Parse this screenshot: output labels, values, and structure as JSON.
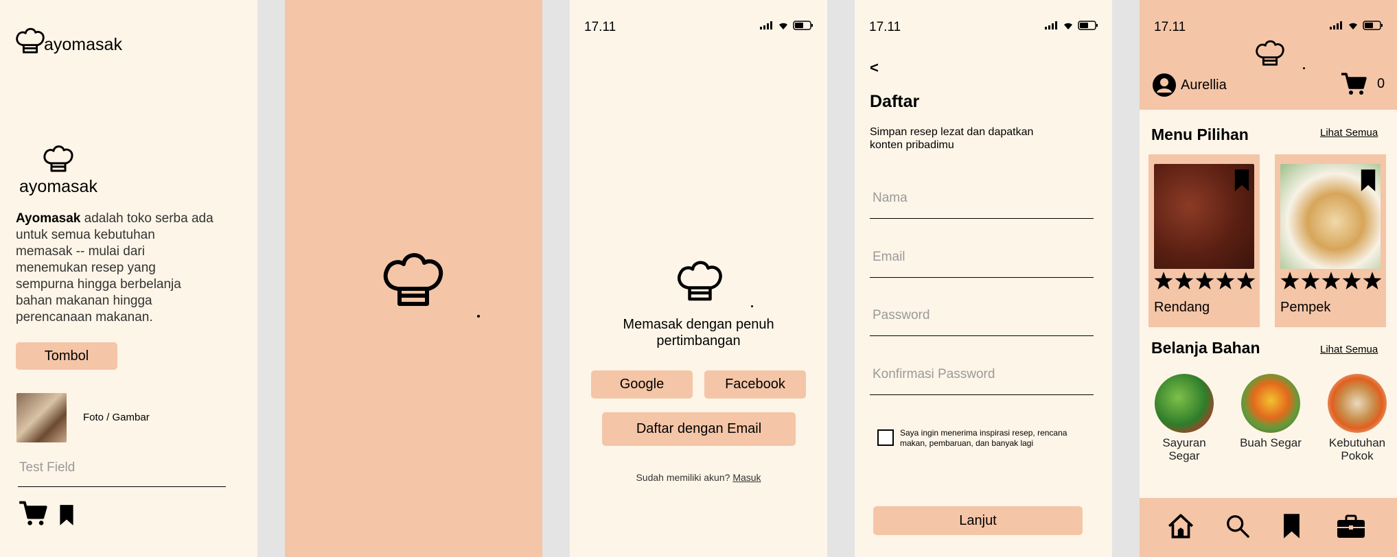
{
  "colors": {
    "peach": "#f4c5a7",
    "cream": "#fdf5e8",
    "gutter": "#e4e4e4"
  },
  "style_guide": {
    "logo_text": "ayomasak",
    "logo2_text": "ayomasak",
    "desc_bold": "Ayomasak",
    "desc_rest": " adalah toko serba ada untuk semua kebutuhan memasak -- mulai dari menemukan resep yang sempurna hingga berbelanja bahan makanan hingga perencanaan makanan.",
    "button_label": "Tombol",
    "photo_label": "Foto / Gambar",
    "text_field_placeholder": "Test Field",
    "icons": [
      "cart-icon",
      "bookmark-icon"
    ]
  },
  "status_bar": {
    "time": "17.11"
  },
  "welcome": {
    "tagline": "Memasak dengan penuh pertimbangan",
    "google_label": "Google",
    "facebook_label": "Facebook",
    "email_signup_label": "Daftar dengan Email",
    "have_account": "Sudah memiliki akun?",
    "login_link": "Masuk"
  },
  "register": {
    "back": "<",
    "title": "Daftar",
    "subtitle": "Simpan resep lezat dan dapatkan konten pribadimu",
    "fields": [
      "Nama",
      "Email",
      "Password",
      "Konfirmasi Password"
    ],
    "consent": "Saya ingin menerima inspirasi resep, rencana makan, pembaruan, dan banyak lagi",
    "continue_label": "Lanjut"
  },
  "home": {
    "user_name": "Aurellia",
    "cart_count": "0",
    "menu_title": "Menu Pilihan",
    "see_all_1": "Lihat Semua",
    "dishes": [
      {
        "name": "Rendang",
        "rating": 5
      },
      {
        "name": "Pempek",
        "rating": 5
      }
    ],
    "shop_title": "Belanja Bahan",
    "see_all_2": "Lihat Semua",
    "categories": [
      "Sayuran Segar",
      "Buah Segar",
      "Kebutuhan Pokok"
    ],
    "nav": [
      "home-icon",
      "search-icon",
      "bookmark-icon",
      "briefcase-icon"
    ]
  }
}
